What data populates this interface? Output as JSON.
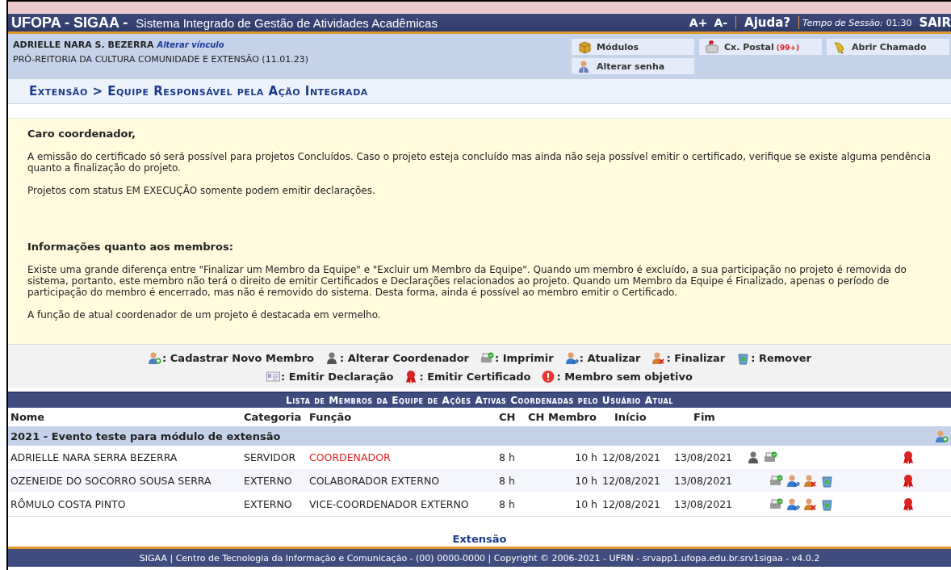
{
  "header": {
    "title": "UFOPA - SIGAA -",
    "subtitle": "Sistema Integrado de Gestão de Atividades Acadêmicas",
    "font_up": "A+",
    "font_down": "A-",
    "help": "Ajuda?",
    "session_label": "Tempo de Sessão:",
    "session_time": "01:30",
    "logout": "SAIR"
  },
  "user": {
    "name": "ADRIELLE NARA S. BEZERRA",
    "change_link": "Alterar vínculo",
    "unit": "PRÓ-REITORIA DA CULTURA COMUNIDADE E EXTENSÃO (11.01.23)"
  },
  "shortcuts": [
    {
      "kind": "modules",
      "label": "Módulos"
    },
    {
      "kind": "mail",
      "label": "Cx. Postal",
      "badge": "(99+)"
    },
    {
      "kind": "bell",
      "label": "Abrir Chamado"
    },
    {
      "kind": "password",
      "label": "Alterar senha"
    }
  ],
  "breadcrumb": "Extensão > Equipe Responsável pela Ação Integrada",
  "notice": {
    "greeting": "Caro coordenador,",
    "paragraphs": [
      "A emissão do certificado só será possível para projetos Concluídos. Caso o projeto esteja concluído mas ainda não seja possível emitir o certificado, verifique se existe alguma pendência quanto a finalização do projeto.",
      "Projetos com status EM EXECUÇÃO somente podem emitir declarações."
    ],
    "members_title": "Informações quanto aos membros:",
    "members_paragraphs": [
      "Existe uma grande diferença entre \"Finalizar um Membro da Equipe\" e \"Excluir um Membro da Equipe\". Quando um membro é excluído, a sua participação no projeto é removida do sistema, portanto, este membro não terá o direito de emitir Certificados e Declarações relacionados ao projeto. Quando um Membro da Equipe é Finalizado, apenas o período de participação do membro é encerrado, mas não é removido do sistema. Desta forma, ainda é possível ao membro emitir o Certificado.",
      "A função de atual coordenador de um projeto é destacada em vermelho."
    ]
  },
  "legend": [
    [
      {
        "kind": "add",
        "label": ": Cadastrar Novo Membro"
      },
      {
        "kind": "coordinator",
        "label": ": Alterar Coordenador"
      },
      {
        "kind": "print",
        "label": ": Imprimir"
      },
      {
        "kind": "update",
        "label": ": Atualizar"
      },
      {
        "kind": "finalize",
        "label": ": Finalizar"
      },
      {
        "kind": "remove",
        "label": ": Remover"
      }
    ],
    [
      {
        "kind": "declaration",
        "label": ": Emitir Declaração"
      },
      {
        "kind": "certificate",
        "label": ": Emitir Certificado"
      },
      {
        "kind": "warning",
        "label": ": Membro sem objetivo"
      }
    ]
  ],
  "table": {
    "title": "Lista de Membros da Equipe de Ações Ativas Coordenadas pelo Usuário Atual",
    "columns": [
      "Nome",
      "Categoria",
      "Função",
      "CH",
      "CH Membro",
      "Início",
      "Fim"
    ],
    "group": {
      "title": "2021 - Evento teste para módulo de extensão",
      "action": {
        "kind": "add"
      }
    },
    "rows": [
      {
        "name": "ADRIELLE NARA SERRA BEZERRA",
        "category": "SERVIDOR",
        "role": "COORDENADOR",
        "coordinator": true,
        "ch": "8 h",
        "ch_member": "10 h",
        "start": "12/08/2021",
        "end": "13/08/2021",
        "actions": [
          {
            "kind": "coordinator"
          },
          {
            "kind": "print"
          }
        ],
        "certificate": true
      },
      {
        "name": "OZENEIDE DO SOCORRO SOUSA SERRA",
        "category": "EXTERNO",
        "role": "COLABORADOR EXTERNO",
        "coordinator": false,
        "ch": "8 h",
        "ch_member": "10 h",
        "start": "12/08/2021",
        "end": "13/08/2021",
        "actions": [
          {
            "kind": "print"
          },
          {
            "kind": "update"
          },
          {
            "kind": "finalize"
          },
          {
            "kind": "remove"
          }
        ],
        "certificate": true
      },
      {
        "name": "RÔMULO COSTA PINTO",
        "category": "EXTERNO",
        "role": "VICE-COORDENADOR EXTERNO",
        "coordinator": false,
        "ch": "8 h",
        "ch_member": "10 h",
        "start": "12/08/2021",
        "end": "13/08/2021",
        "actions": [
          {
            "kind": "print"
          },
          {
            "kind": "update"
          },
          {
            "kind": "finalize"
          },
          {
            "kind": "remove"
          }
        ],
        "certificate": true
      }
    ]
  },
  "footer": {
    "link": "Extensão",
    "text": "SIGAA | Centro de Tecnologia da Informação e Comunicação - (00) 0000-0000 | Copyright © 2006-2021 - UFRN - srvapp1.ufopa.edu.br.srv1sigaa - v4.0.2"
  }
}
